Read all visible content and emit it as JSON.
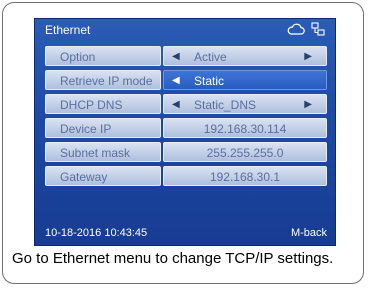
{
  "screen": {
    "title": "Ethernet",
    "icons": [
      "cloud-icon",
      "network-icon"
    ]
  },
  "rows": [
    {
      "label": "Option",
      "value": "Active",
      "type": "select"
    },
    {
      "label": "Retrieve IP mode",
      "value": "Static",
      "type": "select",
      "selected": true
    },
    {
      "label": "DHCP DNS",
      "value": "Static_DNS",
      "type": "select"
    },
    {
      "label": "Device IP",
      "value": "192.168.30.114",
      "type": "text"
    },
    {
      "label": "Subnet mask",
      "value": "255.255.255.0",
      "type": "text"
    },
    {
      "label": "Gateway",
      "value": "192.168.30.1",
      "type": "text"
    }
  ],
  "footer": {
    "datetime": "10-18-2016 10:43:45",
    "back_label": "M-back"
  },
  "caption": "Go to Ethernet menu to change TCP/IP settings."
}
